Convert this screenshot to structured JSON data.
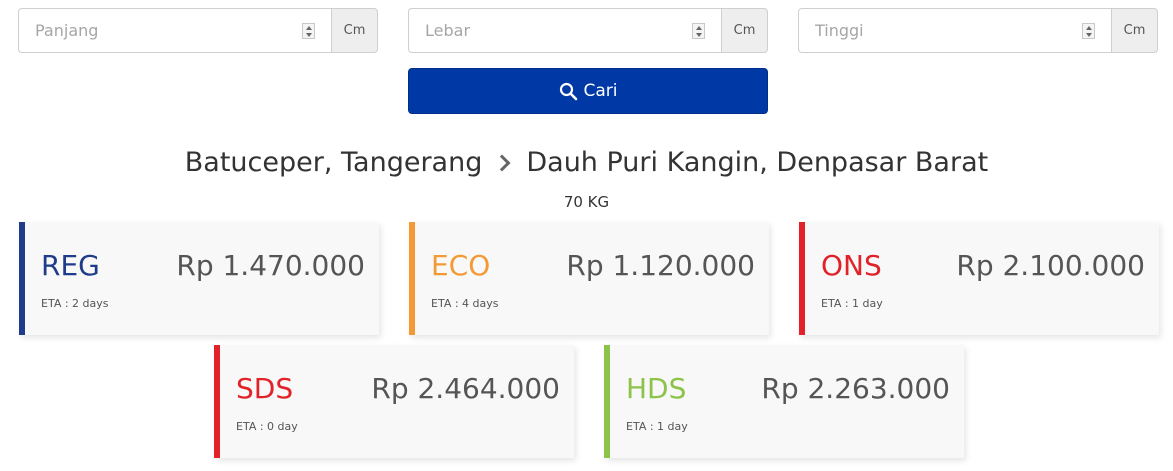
{
  "fields": [
    {
      "placeholder": "Panjang",
      "unit": "Cm"
    },
    {
      "placeholder": "Lebar",
      "unit": "Cm"
    },
    {
      "placeholder": "Tinggi",
      "unit": "Cm"
    }
  ],
  "search": {
    "label": "Cari",
    "color": "#0039a6"
  },
  "route": {
    "origin": "Batuceper, Tangerang",
    "destination": "Dauh Puri Kangin, Denpasar Barat",
    "weight": "70 KG"
  },
  "services": [
    {
      "code": "REG",
      "price": "Rp 1.470.000",
      "eta": "ETA : 2 days",
      "color": "#1f3c8a"
    },
    {
      "code": "ECO",
      "price": "Rp 1.120.000",
      "eta": "ETA : 4 days",
      "color": "#f39a36"
    },
    {
      "code": "ONS",
      "price": "Rp 2.100.000",
      "eta": "ETA : 1 day",
      "color": "#e12228"
    },
    {
      "code": "SDS",
      "price": "Rp 2.464.000",
      "eta": "ETA : 0 day",
      "color": "#e12228"
    },
    {
      "code": "HDS",
      "price": "Rp 2.263.000",
      "eta": "ETA : 1 day",
      "color": "#8dc34a"
    }
  ]
}
